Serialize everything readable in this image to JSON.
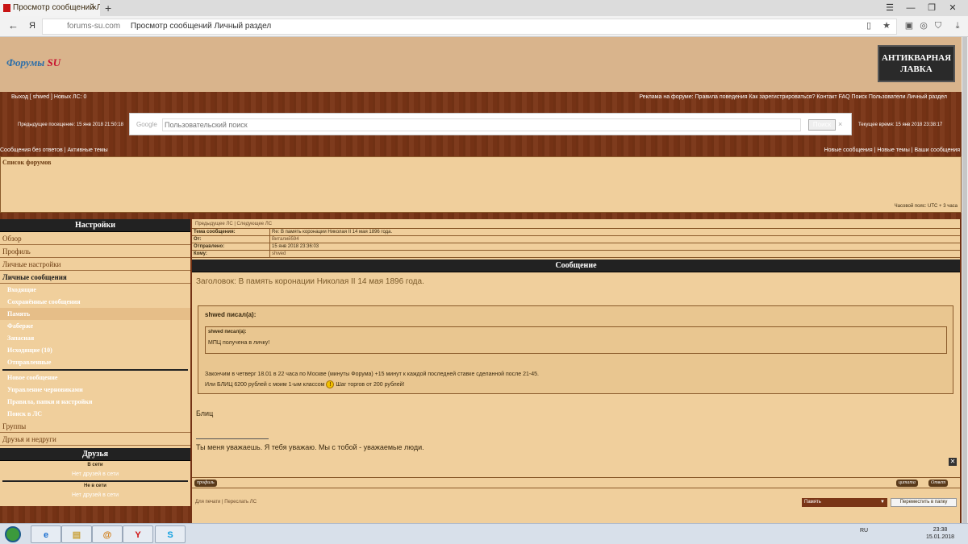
{
  "browser": {
    "tab_title": "Просмотр сообщений Л",
    "tab_close": "×",
    "new_tab": "+",
    "host": "forums-su.com",
    "page_title": "Просмотр сообщений Личный раздел",
    "yandex": "Я"
  },
  "header": {
    "logo": "Форумы",
    "logo_su": "SU",
    "banner_line1": "АНТИКВАРНАЯ",
    "banner_line2": "ЛАВКА"
  },
  "topnav": {
    "left": "Выход [ shwed ]   Новых ЛС: 0",
    "right": "Реклама на форуме:  Правила поведения  Как зарегистрироваться?   Контакт   FAQ   Поиск   Пользователи   Личный раздел"
  },
  "search": {
    "last_visit": "Предыдущее посещение: 15 янв 2018 21:50:18",
    "current_time": "Текущее время: 15 янв 2018 23:38:17",
    "google": "Google",
    "placeholder": "Пользовательский поиск",
    "button": "Поиск",
    "clear": "×"
  },
  "subnav": {
    "left": "Сообщения без ответов  |  Активные темы",
    "right": "Новые сообщения | Новые темы | Ваши сообщения"
  },
  "crumb": {
    "label": "Список форумов",
    "timezone": "Часовой пояс: UTC + 3 часа"
  },
  "settings": {
    "title": "Настройки",
    "overview": "Обзор",
    "profile": "Профиль",
    "personal": "Личные настройки",
    "pm": "Личные сообщения",
    "items": [
      "Входящие",
      "Сохранённые сообщения",
      "Память",
      "Фаберже",
      "Запасная",
      "Исходящие (10)",
      "Отправленные"
    ],
    "actions": [
      "Новое сообщение",
      "Управление черновиками",
      "Правила, папки и настройки",
      "Поиск в ЛС"
    ],
    "groups": "Группы",
    "friends_foes": "Друзья и недруги"
  },
  "friends": {
    "title": "Друзья",
    "online": "В сети",
    "online_empty": "Нет друзей в сети",
    "offline": "Не в сети",
    "offline_empty": "Нет друзей в сети"
  },
  "message": {
    "nav": "Предыдущее ЛС  |  Следующее ЛС",
    "subject_k": "Тема сообщения:",
    "subject_v": "Re: В память коронации Николая II 14 мая 1896 года.",
    "from_k": "От:",
    "from_v": "Виталий594",
    "sent_k": "Отправлено:",
    "sent_v": "15 янв 2018 23:36:03",
    "to_k": "Кому:",
    "to_v": "shwed",
    "head": "Сообщение",
    "title": "Заголовок: В память коронации Николая II 14 мая 1896 года.",
    "q1_author": "shwed писал(а):",
    "q2_author": "shwed писал(а):",
    "q2_text": "МПЦ получена в личку!",
    "line1": "Закончим в четверг 18.01 в 22 часа по Москве (минуты Форума) +15 минут к каждой последней ставке сделанной после 21-45.",
    "line2a": "Или БЛИЦ 6200 рублей с моим 1-ым классом",
    "line2b": "Шаг торгов от 200 рублей!",
    "blitz": "Блиц",
    "sig": "Ты меня уважаешь. Я тебя уважаю. Мы с тобой - уважаемые люди.",
    "profile_btn": "профиль",
    "quote_btn": "цитата",
    "reply_btn": "Ответ",
    "footer": "Для печати  |  Переслать ЛС",
    "folder": "Память",
    "move_btn": "Переместить в папку"
  },
  "taskbar": {
    "lang": "RU",
    "time": "23:38",
    "date": "15.01.2018"
  }
}
